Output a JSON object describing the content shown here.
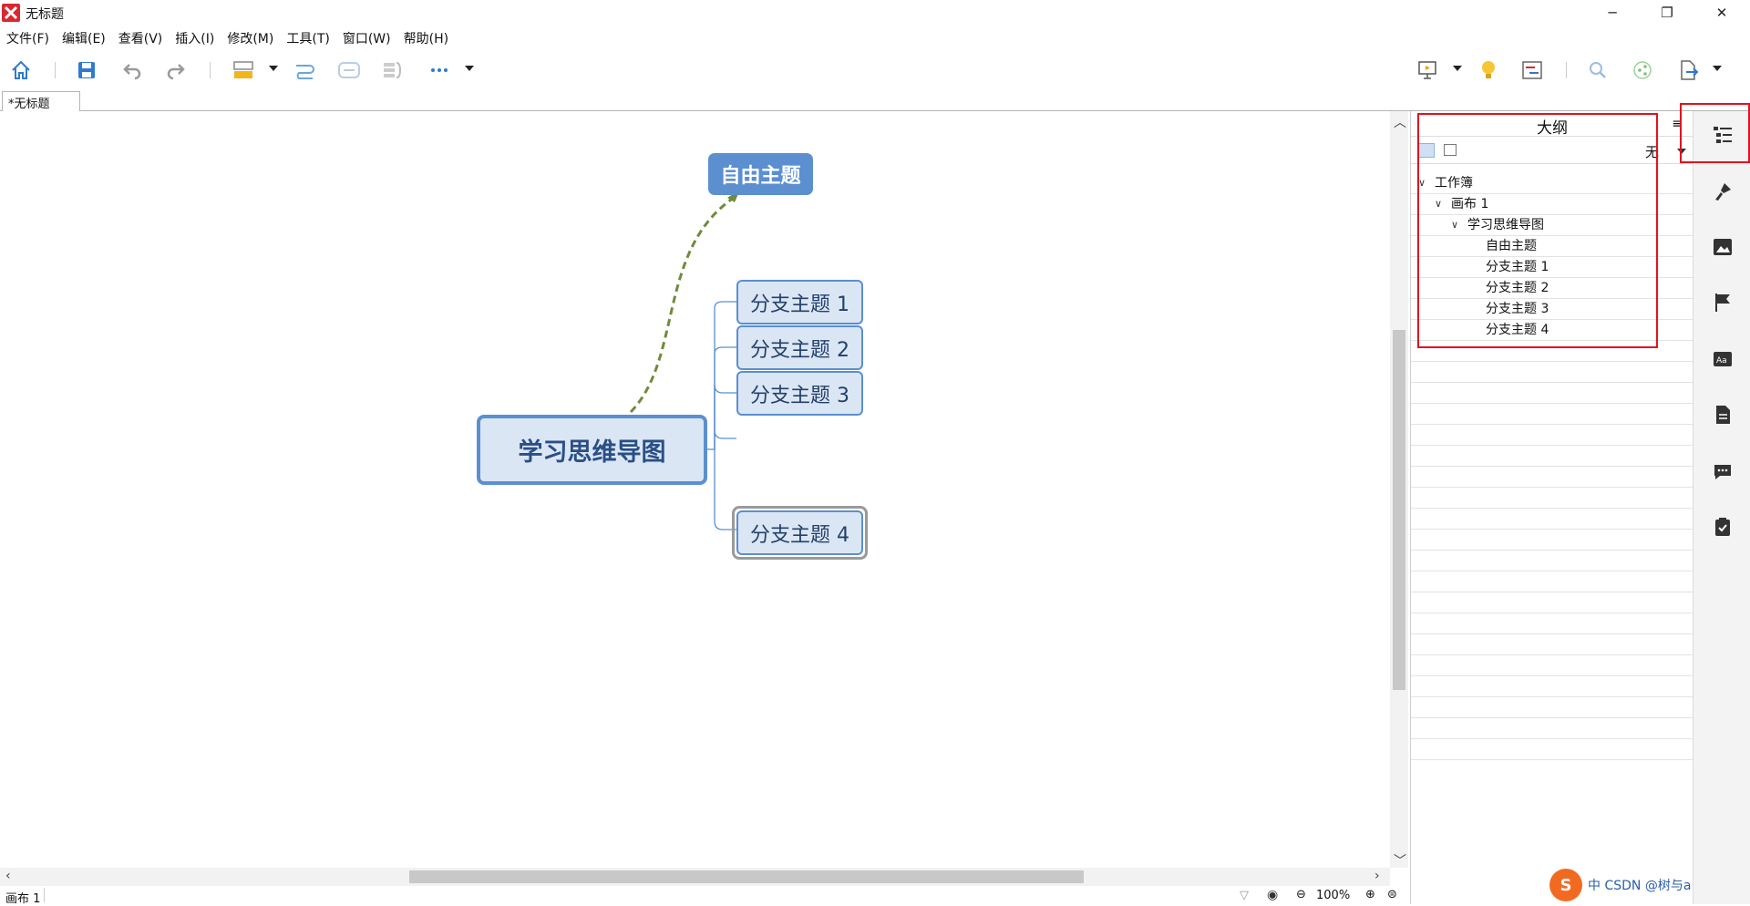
{
  "window": {
    "title": "无标题",
    "minimize": "─",
    "maximize": "❐",
    "close": "✕"
  },
  "menu": [
    "文件(F)",
    "编辑(E)",
    "查看(V)",
    "插入(I)",
    "修改(M)",
    "工具(T)",
    "窗口(W)",
    "帮助(H)"
  ],
  "tab": {
    "label": "*无标题"
  },
  "map": {
    "central": "学习思维导图",
    "floating": "自由主题",
    "branches": [
      "分支主题 1",
      "分支主题 2",
      "分支主题 3",
      "分支主题 4"
    ]
  },
  "outline": {
    "title": "大纲",
    "filter": "无",
    "rows": [
      {
        "label": "工作簿",
        "level": 0,
        "expanded": true
      },
      {
        "label": "画布 1",
        "level": 1,
        "expanded": true
      },
      {
        "label": "学习思维导图",
        "level": 2,
        "expanded": true
      },
      {
        "label": "自由主题",
        "level": 3
      },
      {
        "label": "分支主题 1",
        "level": 3
      },
      {
        "label": "分支主题 2",
        "level": 3
      },
      {
        "label": "分支主题 3",
        "level": 3
      },
      {
        "label": "分支主题 4",
        "level": 3
      }
    ]
  },
  "status": {
    "sheet": "画布 1",
    "zoom": "100%"
  },
  "watermark": {
    "badge": "S",
    "text": "中 CSDN @树与a"
  },
  "colors": {
    "accent": "#5b8fd0",
    "topic_fill": "#dbe6f4",
    "relationship": "#6e8c3a",
    "highlight": "#e0141e"
  }
}
